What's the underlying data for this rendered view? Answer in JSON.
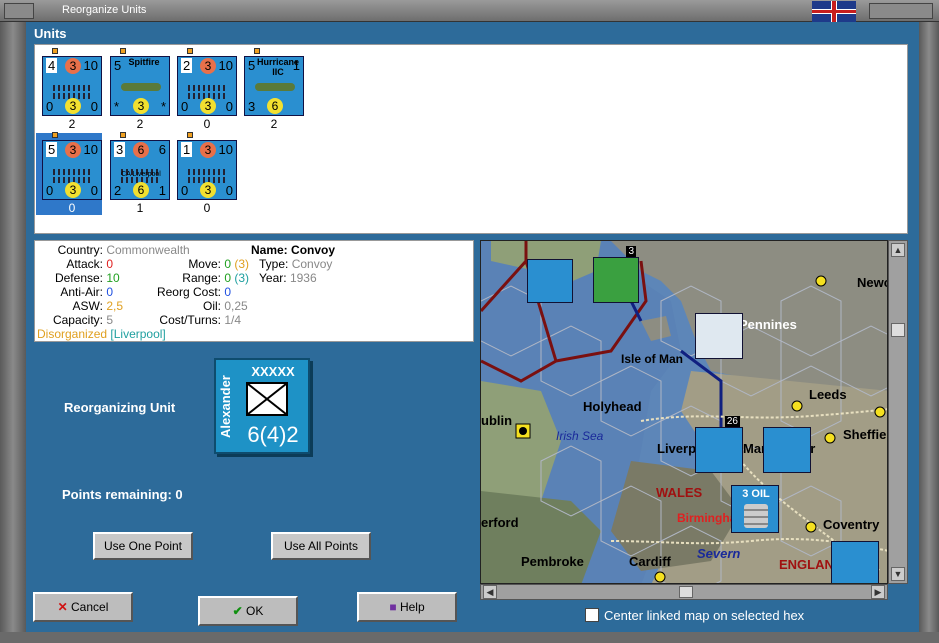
{
  "window": {
    "title": "Reorganize Units"
  },
  "units_section": {
    "title": "Units",
    "units": [
      {
        "name": "Convoy",
        "top_left": "4",
        "attack": "3",
        "top_right": "10",
        "bl": "0",
        "aa": "3",
        "br": "0",
        "count": "2"
      },
      {
        "name": "Spitfire",
        "top_left": "5",
        "attack": "",
        "top_right": "",
        "bl": "*",
        "aa": "3",
        "br": "*",
        "count": "2"
      },
      {
        "name": "Convoy",
        "top_left": "2",
        "attack": "3",
        "top_right": "10",
        "bl": "0",
        "aa": "3",
        "br": "0",
        "count": "0"
      },
      {
        "name": "Hurricane IIC",
        "top_left": "5",
        "attack": "",
        "top_right": "1",
        "bl": "3",
        "aa": "6",
        "br": "",
        "count": "2"
      },
      {
        "name": "Convoy",
        "top_left": "5",
        "attack": "3",
        "top_right": "10",
        "bl": "0",
        "aa": "3",
        "br": "0",
        "count": "0"
      },
      {
        "name": "CA Liverpool",
        "top_left": "3",
        "attack": "6",
        "top_right": "6",
        "bl": "2",
        "aa": "6",
        "br": "1",
        "count": "1"
      },
      {
        "name": "Convoy",
        "top_left": "1",
        "attack": "3",
        "top_right": "10",
        "bl": "0",
        "aa": "3",
        "br": "0",
        "count": "0"
      }
    ]
  },
  "info": {
    "country_label": "Country:",
    "country": "Commonwealth",
    "attack_label": "Attack:",
    "attack": "0",
    "defense_label": "Defense:",
    "defense": "10",
    "antiair_label": "Anti-Air:",
    "antiair": "0",
    "asw_label": "ASW:",
    "asw": "2,5",
    "capacity_label": "Capacity:",
    "capacity": "5",
    "status": "Disorganized",
    "location": "[Liverpool]",
    "name_label": "Name:",
    "name": "Convoy",
    "move_label": "Move:",
    "move": "0",
    "move_max": "(3)",
    "range_label": "Range:",
    "range": "0",
    "range_max": "(3)",
    "reorg_label": "Reorg Cost:",
    "reorg": "0",
    "oil_label": "Oil:",
    "oil": "0,25",
    "cost_label": "Cost/Turns:",
    "cost": "1/4",
    "type_label": "Type:",
    "type": "Convoy",
    "year_label": "Year:",
    "year": "1936"
  },
  "reorganizing": {
    "label": "Reorganizing Unit",
    "unit_name": "Alexander",
    "unit_size": "XXXXX",
    "unit_strength": "6(4)2"
  },
  "points": {
    "label": "Points remaining:",
    "value": "0"
  },
  "buttons": {
    "use_one": "Use One Point",
    "use_all": "Use All Points",
    "cancel": "Cancel",
    "ok": "OK",
    "help": "Help"
  },
  "map": {
    "labels": [
      "Newcastle",
      "Pennines",
      "Isle of Man",
      "Leeds",
      "Holyhead",
      "Irish Sea",
      "ublin",
      "Sheffield",
      "Liverpool",
      "Manchester",
      "WALES",
      "Birmingham",
      "Coventry",
      "erford",
      "Pembroke",
      "Cardiff",
      "Severn",
      "ENGLAND"
    ],
    "oil_label": "3 OIL",
    "stack_count_1": "3",
    "stack_count_2": "26",
    "center_checkbox": "Center linked map on selected hex"
  },
  "colors": {
    "panel": "#2d6b9a",
    "unit_blue": "#2a8fd0",
    "attack_red": "#e8704a",
    "aa_yellow": "#f2e030"
  }
}
